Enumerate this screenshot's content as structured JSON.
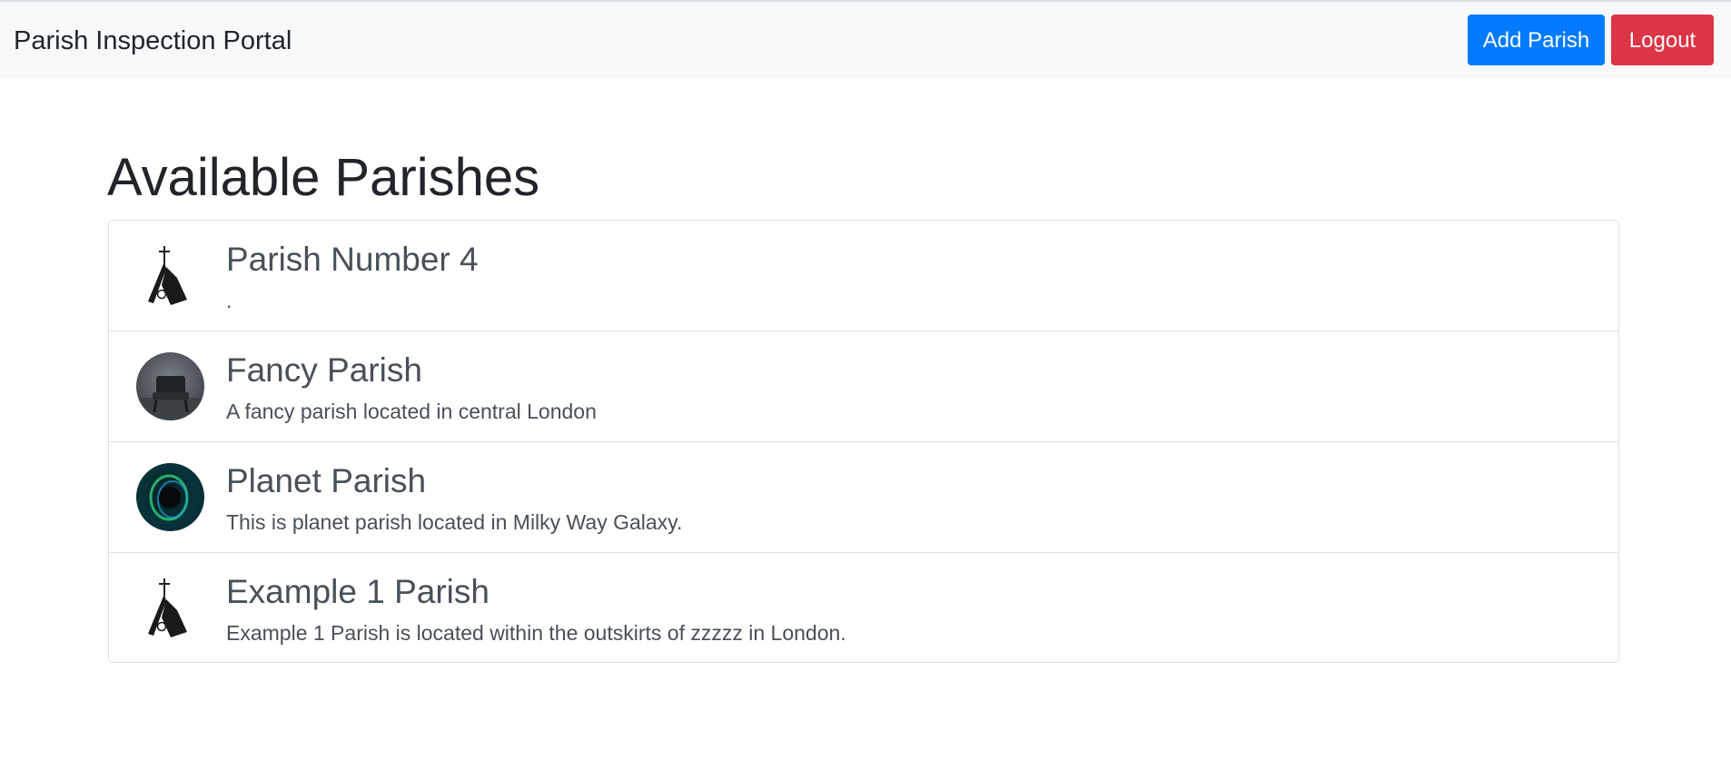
{
  "header": {
    "brand": "Parish Inspection Portal",
    "add_label": "Add Parish",
    "logout_label": "Logout"
  },
  "main": {
    "title": "Available Parishes",
    "parishes": [
      {
        "name": "Parish Number 4",
        "description": ".",
        "image": "church-icon"
      },
      {
        "name": "Fancy Parish",
        "description": "A fancy parish located in central London",
        "image": "chair-photo"
      },
      {
        "name": "Planet Parish",
        "description": "This is planet parish located in Milky Way Galaxy.",
        "image": "planet-photo"
      },
      {
        "name": "Example 1 Parish",
        "description": "Example 1 Parish is located within the outskirts of zzzzz in London.",
        "image": "church-icon"
      }
    ]
  },
  "colors": {
    "primary": "#007bff",
    "danger": "#dc3545",
    "navbar_bg": "#f8f9fa",
    "text": "#212529",
    "muted_text": "#495057"
  }
}
